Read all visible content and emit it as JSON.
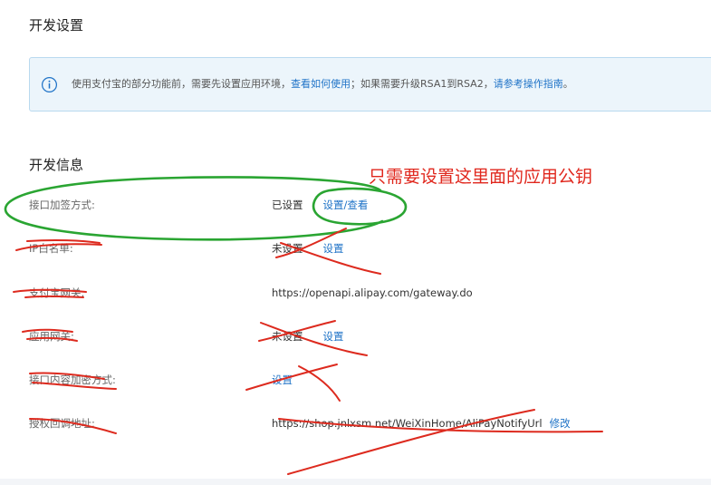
{
  "page": {
    "section1_title": "开发设置",
    "section2_title": "开发信息"
  },
  "notice": {
    "icon": "info-icon",
    "text_before": "使用支付宝的部分功能前，需要先设置应用环境，",
    "link1": "查看如何使用",
    "text_mid": "；如果需要升级RSA1到RSA2，",
    "link2": "请参考操作指南",
    "text_end": "。"
  },
  "rows": [
    {
      "label": "接口加签方式:",
      "value": "已设置",
      "action": "设置/查看"
    },
    {
      "label": "IP白名单:",
      "value": "未设置",
      "action": "设置"
    },
    {
      "label": "支付宝网关:",
      "value": "https://openapi.alipay.com/gateway.do"
    },
    {
      "label": "应用网关:",
      "value": "未设置",
      "action": "设置"
    },
    {
      "label": "接口内容加密方式:",
      "action": "设置"
    },
    {
      "label": "授权回调地址:",
      "value": "https://shop.jnlxsm.net/WeiXinHome/AliPayNotifyUrl",
      "action": "修改"
    }
  ],
  "annotation": {
    "text": "只需要设置这里面的应用公钥"
  },
  "colors": {
    "link": "#1f73c7",
    "annotation_red": "#e0271d",
    "circle_green": "#2aa532"
  }
}
